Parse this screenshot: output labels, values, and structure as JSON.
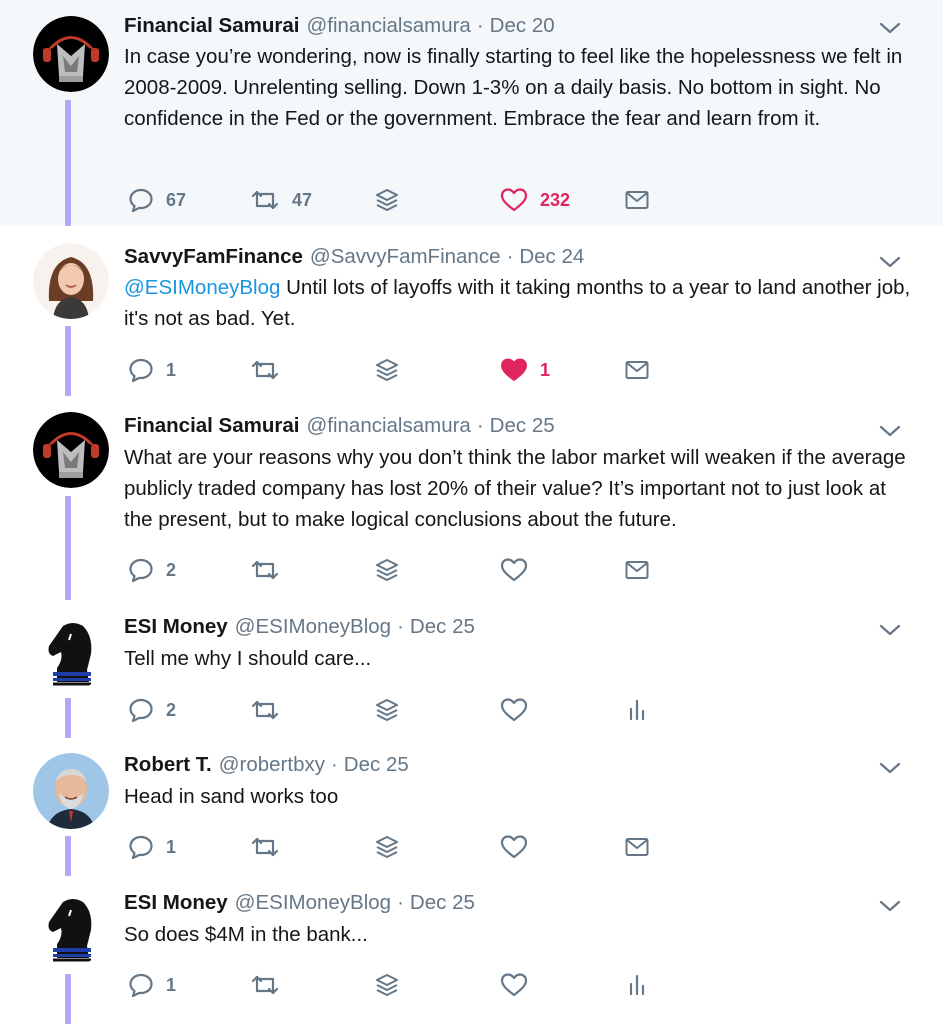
{
  "tweets": [
    {
      "name": "Financial Samurai",
      "handle": "@financialsamura",
      "date": "Dec 20",
      "text": "In case you’re wondering, now is finally starting to feel like the hopelessness we felt in 2008-2009. Unrelenting selling. Down 1-3% on a daily basis. No bottom in sight. No confidence in the Fed or the government. Embrace the fear and learn from it.",
      "replies": "67",
      "retweets": "47",
      "likes": "232",
      "liked": true,
      "trailing_icon": "envelope-icon",
      "avatar": "samurai-avatar"
    },
    {
      "name": "SavvyFamFinance",
      "handle": "@SavvyFamFinance",
      "date": "Dec 24",
      "mention": "@ESIMoneyBlog",
      "text": " Until lots of layoffs with it taking months to a year to land another job, it's not as bad. Yet.",
      "replies": "1",
      "retweets": "",
      "likes": "1",
      "liked": true,
      "liked_filled": true,
      "trailing_icon": "envelope-icon",
      "avatar": "woman-avatar"
    },
    {
      "name": "Financial Samurai",
      "handle": "@financialsamura",
      "date": "Dec 25",
      "text": "What are your reasons why you don’t think the labor market will weaken if the average publicly traded company has lost 20% of their value? It’s important not to just look at the present, but to make logical conclusions about the future.",
      "replies": "2",
      "retweets": "",
      "likes": "",
      "liked": false,
      "trailing_icon": "envelope-icon",
      "avatar": "samurai-avatar"
    },
    {
      "name": "ESI Money",
      "handle": "@ESIMoneyBlog",
      "date": "Dec 25",
      "text": "Tell me why I should care...",
      "replies": "2",
      "retweets": "",
      "likes": "",
      "liked": false,
      "trailing_icon": "analytics-icon",
      "avatar": "knight-avatar"
    },
    {
      "name": "Robert T.",
      "handle": "@robertbxy",
      "date": "Dec 25",
      "text": "Head in sand works too",
      "replies": "1",
      "retweets": "",
      "likes": "",
      "liked": false,
      "trailing_icon": "envelope-icon",
      "avatar": "man-avatar"
    },
    {
      "name": "ESI Money",
      "handle": "@ESIMoneyBlog",
      "date": "Dec 25",
      "text": "So does $4M in the bank...",
      "replies": "1",
      "retweets": "",
      "likes": "",
      "liked": false,
      "trailing_icon": "analytics-icon",
      "avatar": "knight-avatar"
    }
  ],
  "colors": {
    "accent": "#1b95e0",
    "like": "#e0245e",
    "muted": "#657786",
    "thread_line": "#b1a7f5",
    "highlight_bg": "#f5f8fa"
  }
}
